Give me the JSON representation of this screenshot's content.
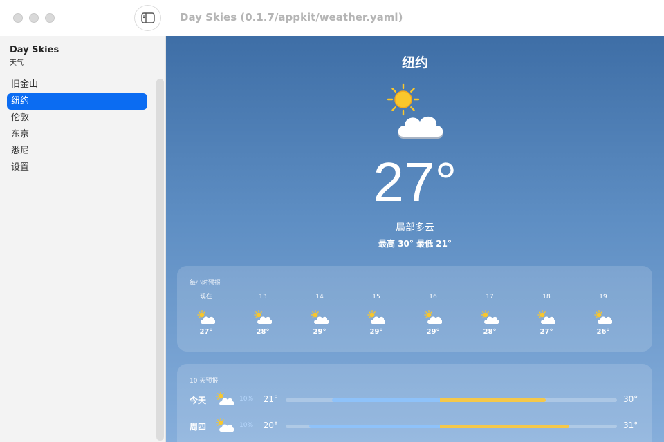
{
  "window": {
    "title": "Day Skies (0.1.7/appkit/weather.yaml)"
  },
  "sidebar": {
    "app_name": "Day Skies",
    "app_subtitle": "天气",
    "items": [
      {
        "label": "旧金山"
      },
      {
        "label": "纽约",
        "selected": true
      },
      {
        "label": "伦敦"
      },
      {
        "label": "东京"
      },
      {
        "label": "悉尼"
      },
      {
        "label": "设置"
      }
    ]
  },
  "current": {
    "city": "纽约",
    "temperature": "27°",
    "condition": "局部多云",
    "high_low": "最高 30° 最低 21°",
    "icon": "partly-cloudy-icon"
  },
  "hourly": {
    "title": "每小时预报",
    "hours": [
      {
        "label": "现在",
        "temp": "27°",
        "icon": "partly-cloudy-icon"
      },
      {
        "label": "13",
        "temp": "28°",
        "icon": "partly-cloudy-icon"
      },
      {
        "label": "14",
        "temp": "29°",
        "icon": "partly-cloudy-icon"
      },
      {
        "label": "15",
        "temp": "29°",
        "icon": "partly-cloudy-icon"
      },
      {
        "label": "16",
        "temp": "29°",
        "icon": "partly-cloudy-icon"
      },
      {
        "label": "17",
        "temp": "28°",
        "icon": "partly-cloudy-icon"
      },
      {
        "label": "18",
        "temp": "27°",
        "icon": "partly-cloudy-icon"
      },
      {
        "label": "19",
        "temp": "26°",
        "icon": "partly-cloudy-icon"
      }
    ]
  },
  "daily": {
    "title": "10 天预报",
    "days": [
      {
        "day": "今天",
        "precip": "10%",
        "low": "21°",
        "high": "30°",
        "icon": "partly-cloudy-icon",
        "range_start": 0.14,
        "range_split": 0.465,
        "range_end": 0.785
      },
      {
        "day": "周四",
        "precip": "10%",
        "low": "20°",
        "high": "31°",
        "icon": "partly-cloudy-icon",
        "range_start": 0.07,
        "range_split": 0.465,
        "range_end": 0.855
      }
    ]
  },
  "colors": {
    "accent": "#0b6cf2",
    "bar_cool": "#8ec2fa",
    "bar_warm": "#f5c84a",
    "sun": "#f9c72c",
    "background_top": "#3e6ea6",
    "background_bottom": "#86aedb"
  }
}
